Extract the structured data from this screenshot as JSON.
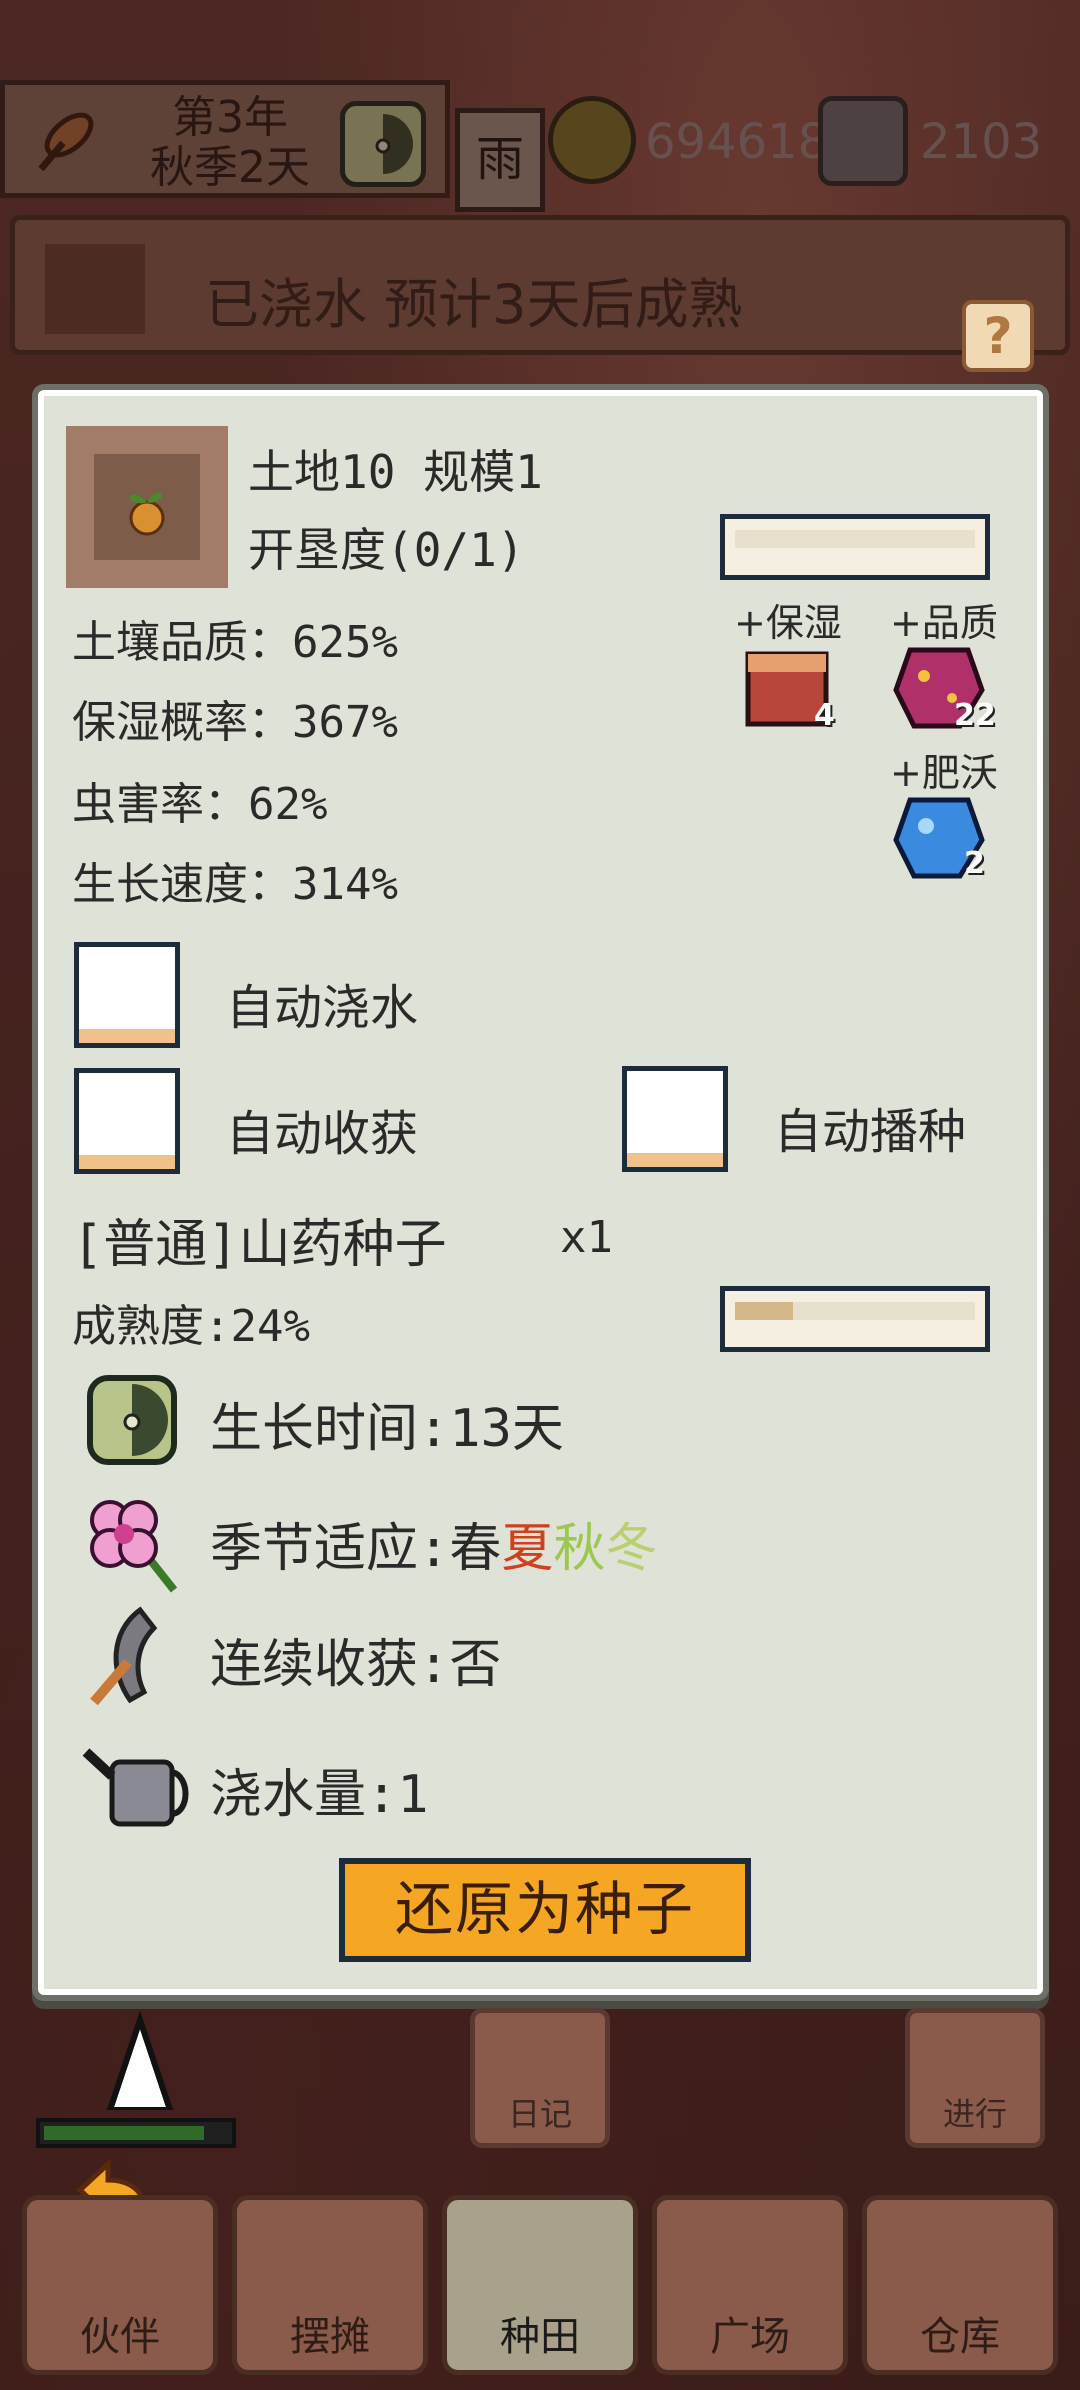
{
  "header": {
    "year_label": "第3年",
    "season_day": "秋季2天",
    "weather": "雨",
    "coins": "694618",
    "gems": "2103",
    "status": "已浇水 预计3天后成熟"
  },
  "help": {
    "label": "?"
  },
  "plot": {
    "title": "土地10 规模1",
    "reclaim": "开垦度(0/1)",
    "reclaim_progress": 0,
    "stats": {
      "soil_quality": "土壤品质：625%",
      "moisture_rate": "保湿概率：367%",
      "pest_rate": "虫害率：62%",
      "growth_speed": "生长速度：314%"
    },
    "items": {
      "moisture_label": "+保湿",
      "moisture_count": "4",
      "quality_label": "+品质",
      "quality_count": "22",
      "fertile_label": "+肥沃",
      "fertile_count": "2"
    }
  },
  "auto": {
    "water": "自动浇水",
    "harvest": "自动收获",
    "sow": "自动播种"
  },
  "seed": {
    "name": "[普通]山药种子",
    "count": "x1",
    "maturity": "成熟度:24%",
    "maturity_progress": 0.24,
    "growth_time": "生长时间:13天",
    "season_prefix": "季节适应:",
    "season_spring": "春",
    "season_summer": "夏",
    "season_autumn": "秋",
    "season_winter": "冬",
    "continuous": "连续收获:否",
    "water_amount": "浇水量:1"
  },
  "colors": {
    "spring": "#2a2a2a",
    "summer": "#d0401c",
    "autumn": "#9cc850",
    "winter": "#b8d070"
  },
  "revert_button": "还原为种子",
  "side_buttons": {
    "diary": "日记",
    "proceed": "进行"
  },
  "tabs": [
    "伙伴",
    "摆摊",
    "种田",
    "广场",
    "仓库"
  ]
}
